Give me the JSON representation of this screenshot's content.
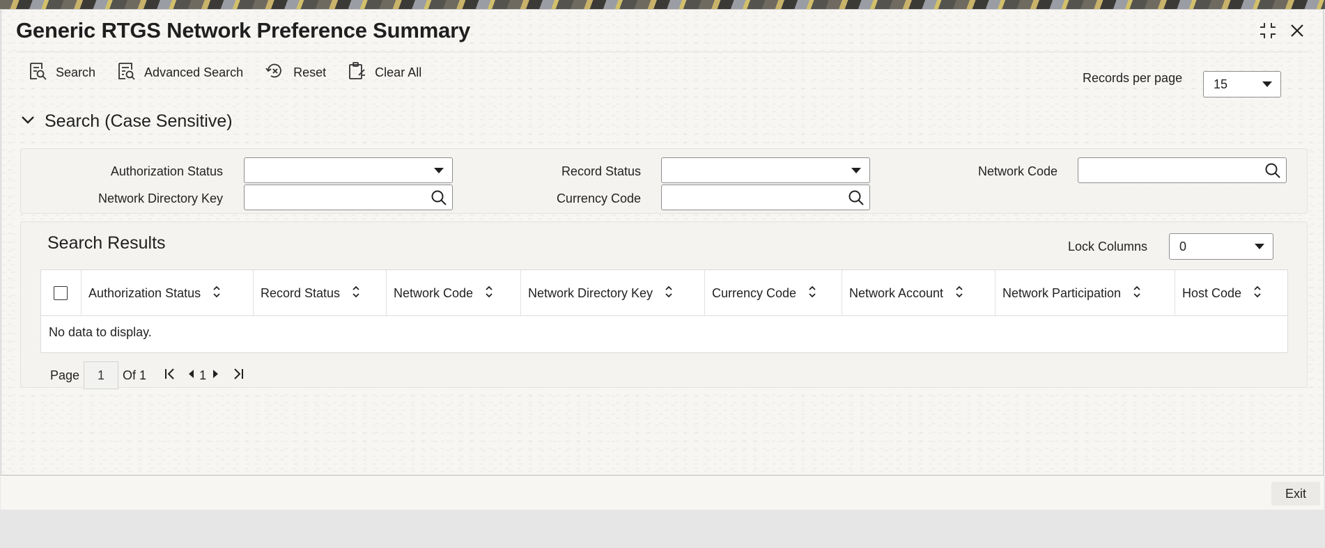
{
  "window": {
    "title": "Generic RTGS Network Preference Summary"
  },
  "toolbar": {
    "search_label": "Search",
    "advanced_search_label": "Advanced Search",
    "reset_label": "Reset",
    "clear_all_label": "Clear All",
    "records_per_page_label": "Records per page",
    "records_per_page_value": "15"
  },
  "search_section": {
    "title": "Search (Case Sensitive)",
    "fields": {
      "authorization_status": {
        "label": "Authorization Status",
        "value": ""
      },
      "record_status": {
        "label": "Record Status",
        "value": ""
      },
      "network_code": {
        "label": "Network Code",
        "value": ""
      },
      "network_directory_key": {
        "label": "Network Directory Key",
        "value": ""
      },
      "currency_code": {
        "label": "Currency Code",
        "value": ""
      }
    }
  },
  "results": {
    "title": "Search Results",
    "lock_columns_label": "Lock Columns",
    "lock_columns_value": "0",
    "columns": [
      "Authorization Status",
      "Record Status",
      "Network Code",
      "Network Directory Key",
      "Currency Code",
      "Network Account",
      "Network Participation",
      "Host Code"
    ],
    "empty_message": "No data to display."
  },
  "pager": {
    "page_label": "Page",
    "page_value": "1",
    "of_label": "Of 1",
    "current_page": "1"
  },
  "footer": {
    "exit_label": "Exit"
  },
  "icons": {
    "search": "search-icon",
    "advanced_search": "advanced-search-icon",
    "reset": "reset-icon",
    "clear_all": "clear-all-icon",
    "expand": "expand-icon",
    "close": "close-icon",
    "collapse": "chevron-down-icon",
    "field_search": "magnifier-icon",
    "sort": "sort-icon"
  },
  "colors": {
    "text": "#1f1f1f",
    "background": "#f7f6f3",
    "border": "#8d8d8d"
  }
}
